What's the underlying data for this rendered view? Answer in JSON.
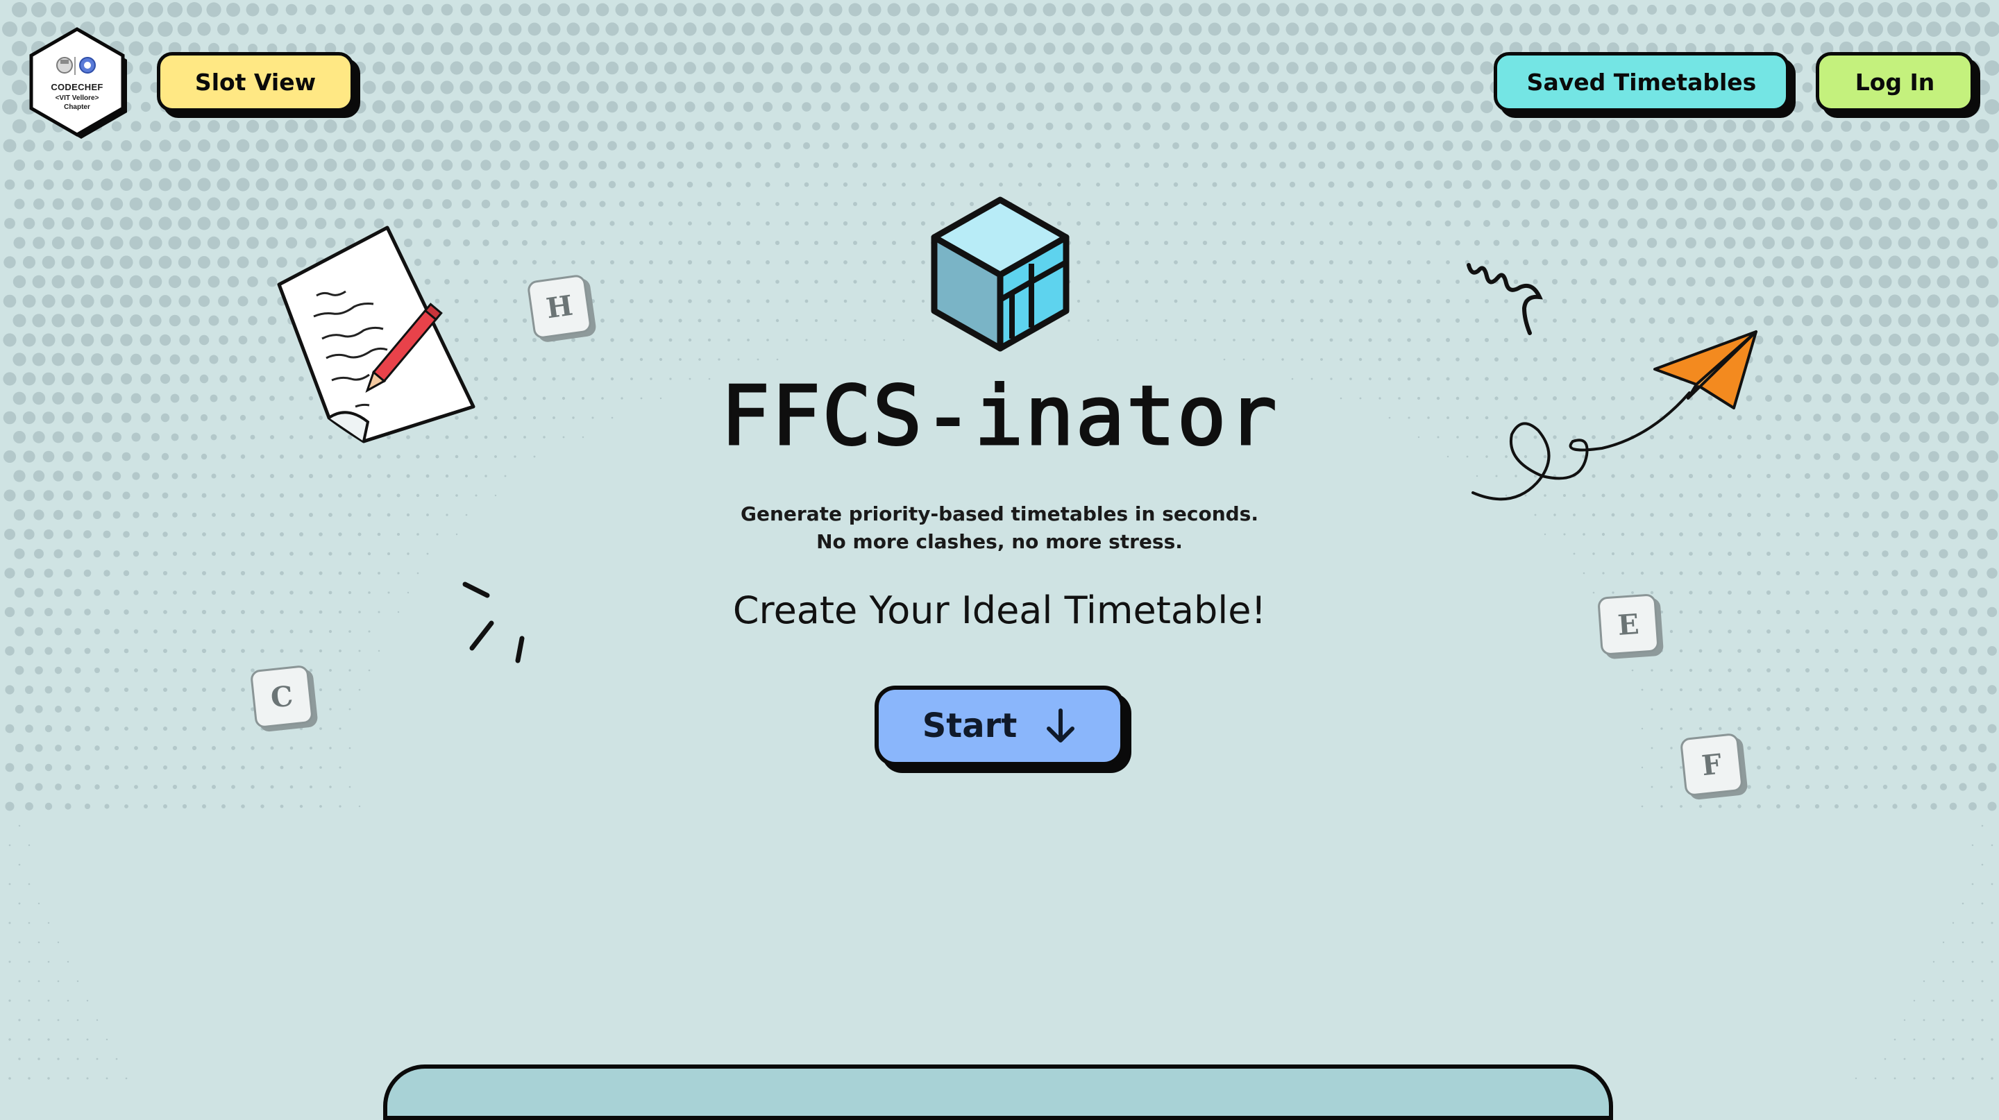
{
  "navbar": {
    "logo": {
      "line1": "CODECHEF",
      "line2": "<VIT Vellore>",
      "line3": "Chapter"
    },
    "slot_view_label": "Slot View",
    "saved_timetables_label": "Saved Timetables",
    "login_label": "Log In"
  },
  "hero": {
    "title": "FFCS-inator",
    "subtitle_line1": "Generate priority-based timetables in seconds.",
    "subtitle_line2": "No more clashes, no more stress.",
    "cta_text": "Create Your Ideal Timetable!",
    "start_label": "Start",
    "start_icon": "arrow-down-icon"
  },
  "decorations": {
    "letter_tiles": [
      "H",
      "C",
      "E",
      "F"
    ],
    "icons": [
      "paper-note-pencil-icon",
      "paper-plane-icon",
      "squiggle-icon",
      "burst-lines-icon",
      "cube-logo-icon"
    ]
  },
  "colors": {
    "background": "#cfe3e3",
    "slot_view": "#ffe884",
    "saved_timetables": "#74e5e4",
    "login": "#c4f17d",
    "start": "#8ab6fb",
    "cube_light": "#b8ecf7",
    "cube_mid": "#5ed3ee",
    "cube_dark": "#7ab4c6",
    "plane_orange": "#f38a1f",
    "pencil_red": "#e8424a"
  }
}
